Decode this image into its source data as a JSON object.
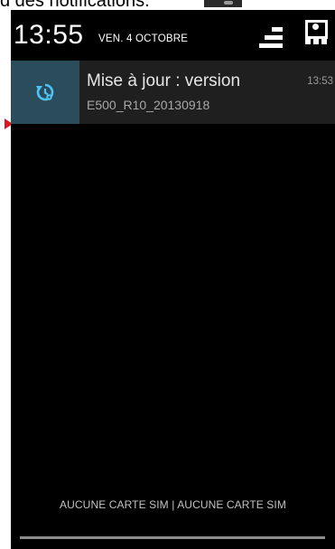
{
  "caption": {
    "text": "d des notifications."
  },
  "header": {
    "time": "13:55",
    "date": "VEN. 4 OCTOBRE"
  },
  "notification": {
    "icon": "system-update-icon",
    "title": "Mise à jour : version",
    "subtitle": "E500_R10_20130918",
    "time": "13:53"
  },
  "footer": {
    "sim_status": "AUCUNE CARTE SIM | AUCUNE CARTE SIM"
  },
  "colors": {
    "background": "#000000",
    "notification_bg": "#1f1f1f",
    "icon_box_bg": "#2a4c5b",
    "icon_accent": "#4fc3f7",
    "arrow": "#e0141e"
  }
}
